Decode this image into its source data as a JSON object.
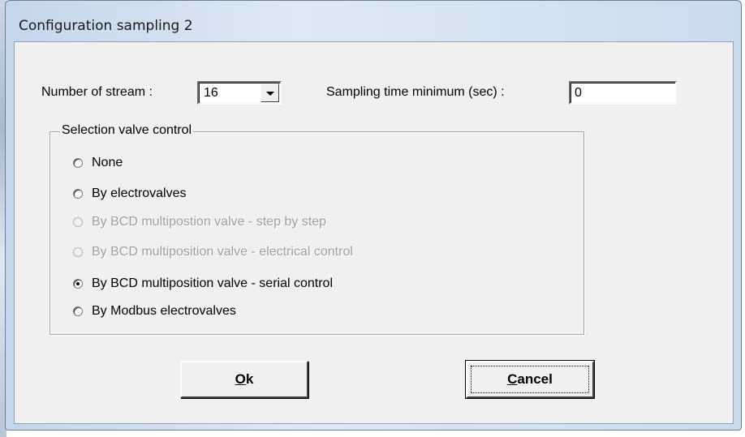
{
  "window": {
    "title": "Configuration sampling 2"
  },
  "stream": {
    "label": "Number of stream :",
    "value": "16"
  },
  "sampling_time": {
    "label": "Sampling time minimum (sec) :",
    "value": "0"
  },
  "valve_control": {
    "group_label": "Selection valve control",
    "options": [
      {
        "label": "None",
        "checked": false,
        "enabled": true
      },
      {
        "label": "By electrovalves",
        "checked": false,
        "enabled": true
      },
      {
        "label": "By BCD multipostion valve - step by step",
        "checked": false,
        "enabled": false
      },
      {
        "label": "By BCD multiposition valve - electrical control",
        "checked": false,
        "enabled": false
      },
      {
        "label": "By BCD multiposition valve - serial control",
        "checked": true,
        "enabled": true
      },
      {
        "label": "By Modbus electrovalves",
        "checked": false,
        "enabled": true
      }
    ]
  },
  "buttons": {
    "ok_mnemonic": "O",
    "ok_rest": "k",
    "cancel_mnemonic": "C",
    "cancel_rest": "ancel"
  }
}
